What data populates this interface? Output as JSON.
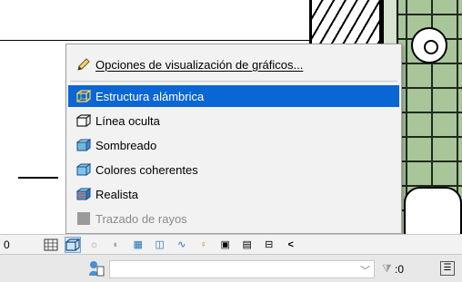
{
  "menu": {
    "items": [
      {
        "label": "Opciones de visualización de gráficos...",
        "underline_first": true,
        "icon": "pencil-icon"
      },
      {
        "label": "Estructura alámbrica",
        "selected": true,
        "icon": "wireframe-cube-icon"
      },
      {
        "label": "Línea oculta",
        "icon": "hidden-line-cube-icon"
      },
      {
        "label": "Sombreado",
        "icon": "shaded-cube-icon"
      },
      {
        "label": "Colores coherentes",
        "icon": "consistent-colors-cube-icon"
      },
      {
        "label": "Realista",
        "icon": "realistic-cube-icon"
      },
      {
        "label": "Trazado de rayos",
        "disabled": true,
        "icon": "ray-trace-icon"
      }
    ]
  },
  "toolbar": {
    "left_text": "0",
    "more_label": "<"
  },
  "statusbar": {
    "filter_value": ":0"
  },
  "colors": {
    "selection": "#0a66d4",
    "drawing_fill": "#a9c59a"
  }
}
